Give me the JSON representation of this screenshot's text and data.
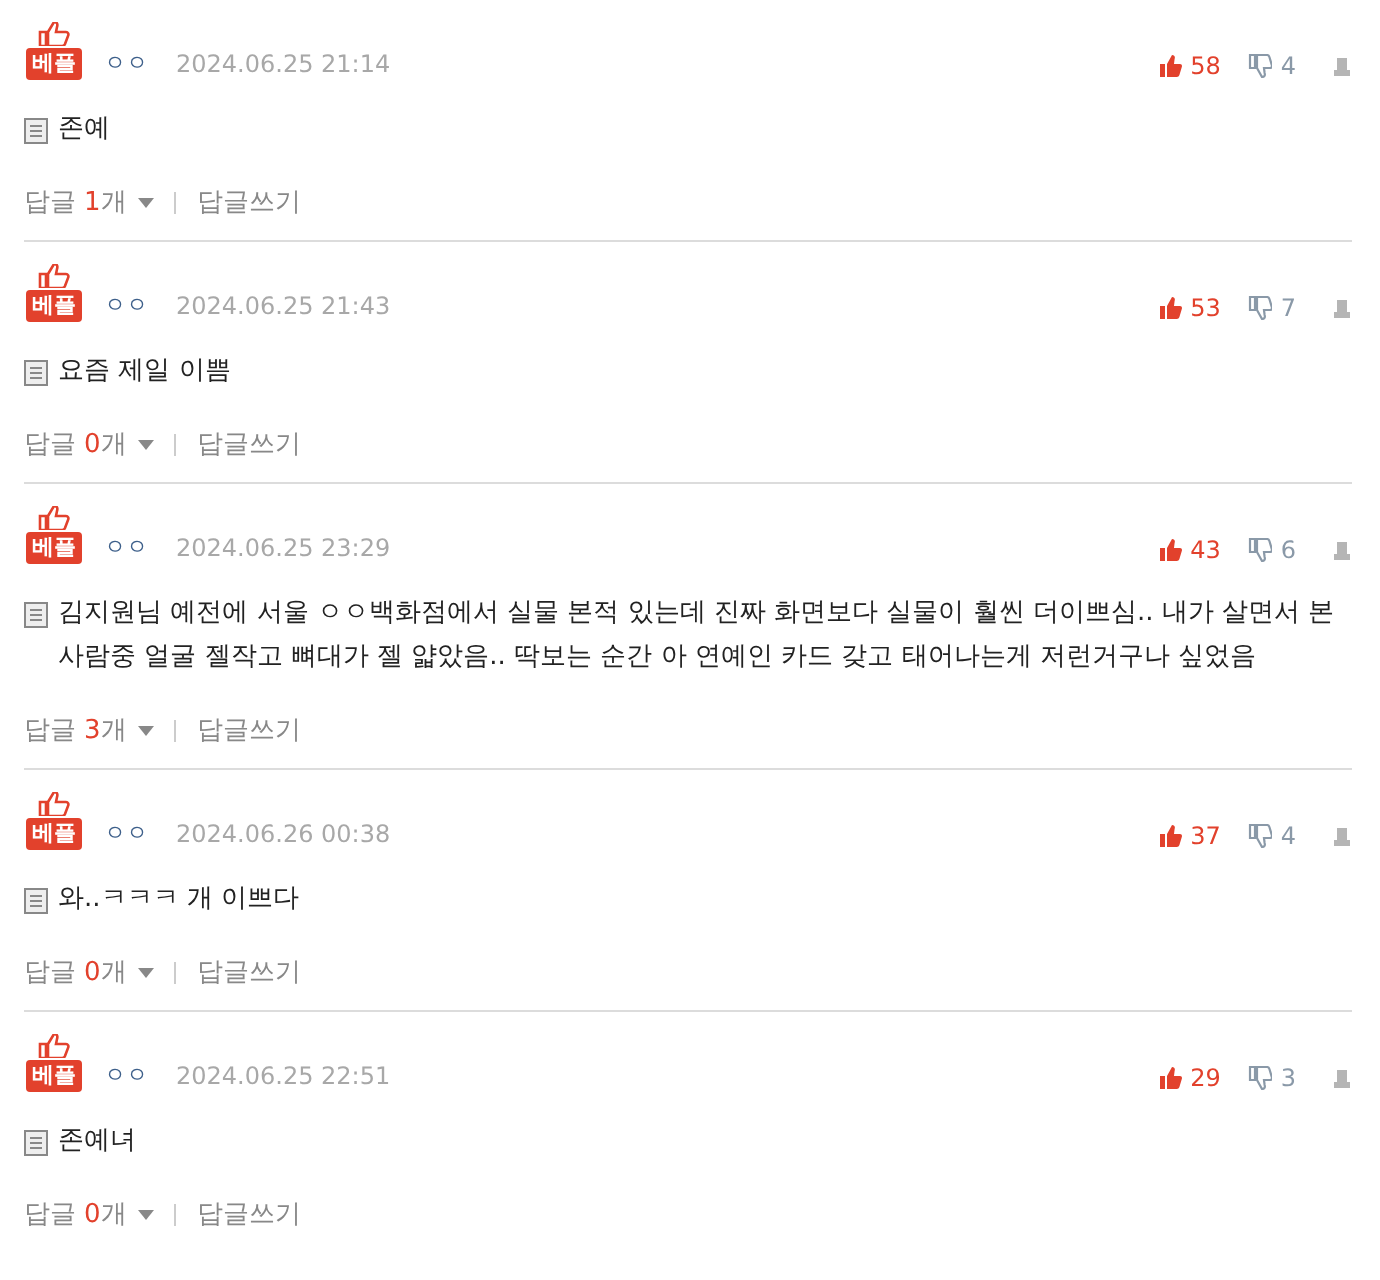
{
  "comments": [
    {
      "badge": "베플",
      "author": "ㅇㅇ",
      "date": "2024.06.25 21:14",
      "likes": "58",
      "dislikes": "4",
      "text": "존예",
      "reply_label": "답글",
      "reply_count": "1",
      "reply_unit": "개",
      "write_reply": "답글쓰기"
    },
    {
      "badge": "베플",
      "author": "ㅇㅇ",
      "date": "2024.06.25 21:43",
      "likes": "53",
      "dislikes": "7",
      "text": "요즘 제일 이쁨",
      "reply_label": "답글",
      "reply_count": "0",
      "reply_unit": "개",
      "write_reply": "답글쓰기"
    },
    {
      "badge": "베플",
      "author": "ㅇㅇ",
      "date": "2024.06.25 23:29",
      "likes": "43",
      "dislikes": "6",
      "text": "김지원님 예전에 서울 ㅇㅇ백화점에서 실물 본적 있는데 진짜 화면보다 실물이 훨씬 더이쁘심.. 내가 살면서 본사람중 얼굴 젤작고 뼈대가 젤 얇았음.. 딱보는 순간 아 연예인 카드 갖고 태어나는게 저런거구나 싶었음",
      "reply_label": "답글",
      "reply_count": "3",
      "reply_unit": "개",
      "write_reply": "답글쓰기"
    },
    {
      "badge": "베플",
      "author": "ㅇㅇ",
      "date": "2024.06.26 00:38",
      "likes": "37",
      "dislikes": "4",
      "text": "와..ㅋㅋㅋ 개 이쁘다",
      "reply_label": "답글",
      "reply_count": "0",
      "reply_unit": "개",
      "write_reply": "답글쓰기"
    },
    {
      "badge": "베플",
      "author": "ㅇㅇ",
      "date": "2024.06.25 22:51",
      "likes": "29",
      "dislikes": "3",
      "text": "존예녀",
      "reply_label": "답글",
      "reply_count": "0",
      "reply_unit": "개",
      "write_reply": "답글쓰기"
    }
  ]
}
